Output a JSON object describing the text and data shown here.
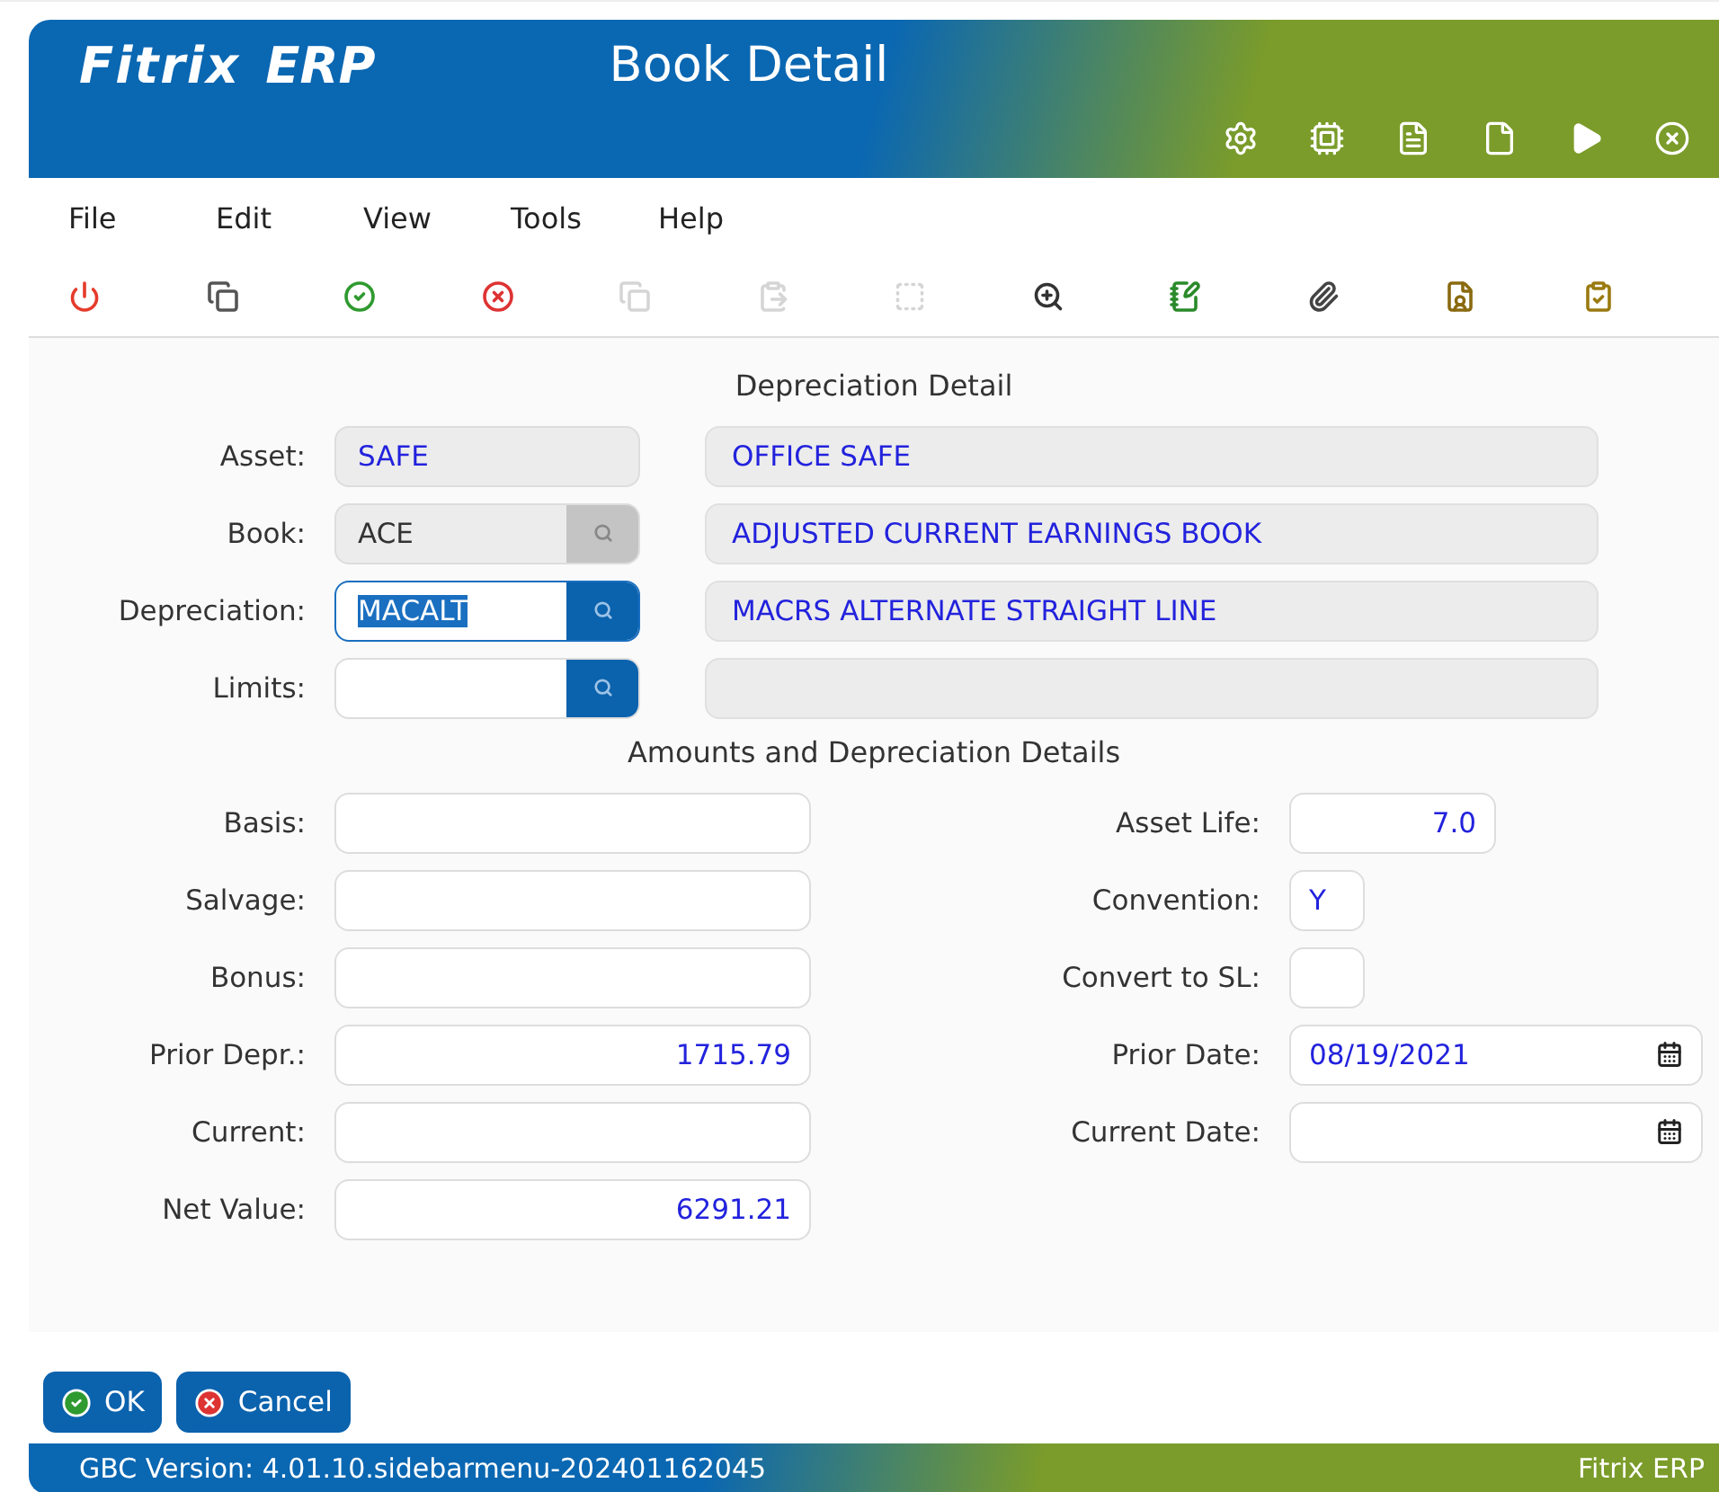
{
  "header": {
    "logo": "Fitrix",
    "logo_suffix": "ERP",
    "title": "Book Detail"
  },
  "menu": [
    "File",
    "Edit",
    "View",
    "Tools",
    "Help"
  ],
  "toolbar": [
    {
      "kind": "power",
      "disabled": false
    },
    {
      "kind": "windows",
      "disabled": false
    },
    {
      "kind": "accept",
      "disabled": false
    },
    {
      "kind": "cancel",
      "disabled": false
    },
    {
      "kind": "copy",
      "disabled": true
    },
    {
      "kind": "paste",
      "disabled": true
    },
    {
      "kind": "select",
      "disabled": true
    },
    {
      "kind": "zoom",
      "disabled": false
    },
    {
      "kind": "notes",
      "disabled": false
    },
    {
      "kind": "attach",
      "disabled": false
    },
    {
      "kind": "owner",
      "disabled": false
    },
    {
      "kind": "checklist",
      "disabled": false
    }
  ],
  "detail": {
    "title": "Depreciation Detail",
    "rows": [
      {
        "label": "Asset:",
        "code": "SAFE",
        "readonly": true,
        "lookup": false,
        "focused": false,
        "description": "OFFICE SAFE"
      },
      {
        "label": "Book:",
        "code": "ACE",
        "readonly": true,
        "lookup": true,
        "lookup_disabled": true,
        "focused": false,
        "description": "ADJUSTED CURRENT EARNINGS BOOK"
      },
      {
        "label": "Depreciation:",
        "code": "MACALT",
        "readonly": false,
        "lookup": true,
        "lookup_disabled": false,
        "focused": true,
        "description": "MACRS ALTERNATE STRAIGHT LINE"
      },
      {
        "label": "Limits:",
        "readonly": false,
        "lookup": true,
        "lookup_disabled": false,
        "focused": false
      }
    ]
  },
  "amounts": {
    "title": "Amounts and Depreciation Details",
    "left": [
      {
        "label": "Basis:"
      },
      {
        "label": "Salvage:"
      },
      {
        "label": "Bonus:"
      },
      {
        "label": "Prior Depr.:",
        "value": "1715.79"
      },
      {
        "label": "Current:"
      },
      {
        "label": "Net Value:",
        "value": "6291.21"
      }
    ],
    "right": [
      {
        "label": "Asset Life:",
        "kind": "number",
        "value": "7.0"
      },
      {
        "label": "Convention:",
        "kind": "short",
        "value": "Y"
      },
      {
        "label": "Convert to SL:",
        "kind": "short"
      },
      {
        "label": "Prior Date:",
        "kind": "date",
        "value": "08/19/2021"
      },
      {
        "label": "Current Date:",
        "kind": "date"
      }
    ]
  },
  "buttons": [
    {
      "kind": "accept",
      "label": "OK"
    },
    {
      "kind": "cancel",
      "label": "Cancel"
    }
  ],
  "status_bar": {
    "version": "GBC Version: 4.01.10.sidebarmenu-202401162045",
    "brand": "Fitrix ERP"
  }
}
